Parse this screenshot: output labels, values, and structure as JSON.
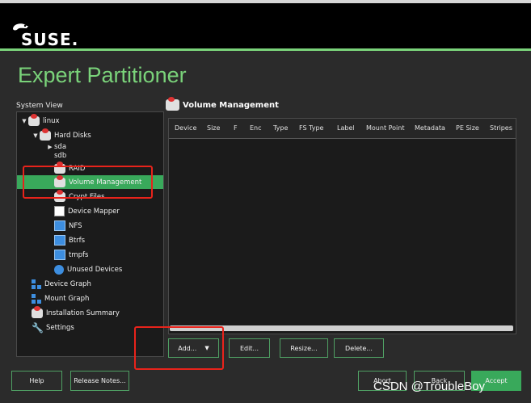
{
  "brand": {
    "logo_text": "SUSE."
  },
  "page": {
    "title": "Expert Partitioner"
  },
  "system_view": {
    "label": "System View",
    "items": [
      {
        "label": "linux"
      },
      {
        "label": "Hard Disks"
      },
      {
        "label": "sda"
      },
      {
        "label": "sdb"
      },
      {
        "label": "RAID"
      },
      {
        "label": "Volume Management"
      },
      {
        "label": "Crypt Files"
      },
      {
        "label": "Device Mapper"
      },
      {
        "label": "NFS"
      },
      {
        "label": "Btrfs"
      },
      {
        "label": "tmpfs"
      },
      {
        "label": "Unused Devices"
      },
      {
        "label": "Device Graph"
      },
      {
        "label": "Mount Graph"
      },
      {
        "label": "Installation Summary"
      },
      {
        "label": "Settings"
      }
    ]
  },
  "volume_management": {
    "heading": "Volume Management",
    "columns": [
      "Device",
      "Size",
      "F",
      "Enc",
      "Type",
      "FS Type",
      "Label",
      "Mount Point",
      "Metadata",
      "PE Size",
      "Stripes"
    ]
  },
  "actions": {
    "add": "Add...",
    "edit": "Edit...",
    "resize": "Resize...",
    "delete": "Delete..."
  },
  "footer": {
    "help": "Help",
    "release_notes": "Release Notes...",
    "abort": "Abort",
    "back": "Back",
    "accept": "Accept"
  },
  "watermark": "CSDN @TroubleBoy",
  "colors": {
    "accent": "#7ad37a",
    "selected": "#39a95b",
    "highlight_box": "#e8231b"
  }
}
